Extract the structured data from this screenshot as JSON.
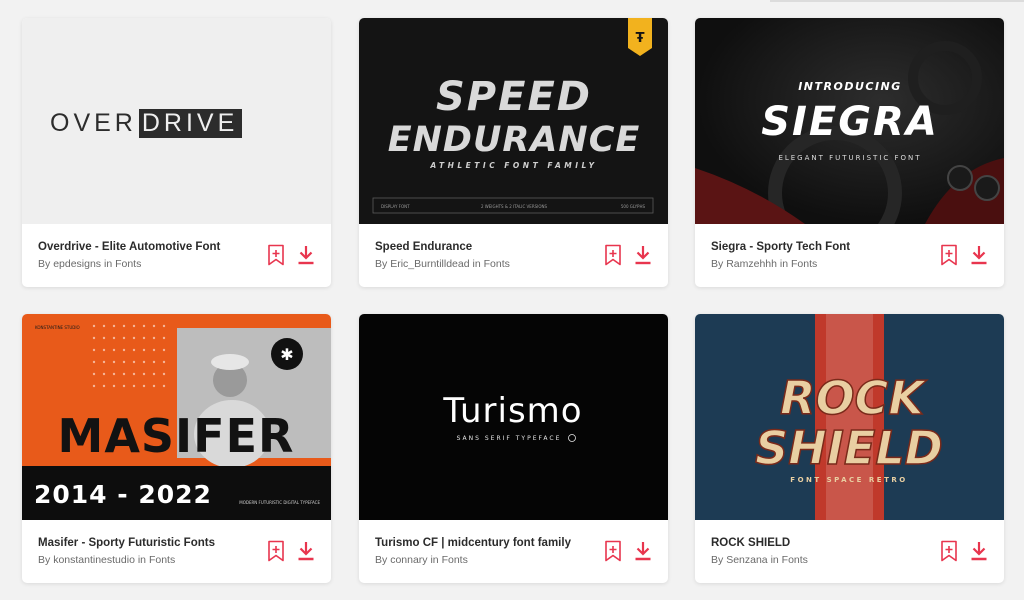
{
  "cards": [
    {
      "title": "Overdrive - Elite Automotive Font",
      "by": "By",
      "author": "epdesigns",
      "in": "in",
      "category": "Fonts",
      "preview": {
        "word_a": "OVER",
        "word_b": "DRIVE"
      }
    },
    {
      "title": "Speed Endurance",
      "by": "By",
      "author": "Eric_Burntilldead",
      "in": "in",
      "category": "Fonts",
      "preview": {
        "line1": "SPEED",
        "line2": "ENDURANCE",
        "tagline": "ATHLETIC FONT FAMILY",
        "footer_left": "DISPLAY FONT",
        "footer_mid": "2 WEIGHTS & 2 ITALIC VERSIONS",
        "footer_right": "500 GLYPHS"
      }
    },
    {
      "title": "Siegra - Sporty Tech Font",
      "by": "By",
      "author": "Ramzehhh",
      "in": "in",
      "category": "Fonts",
      "preview": {
        "intro": "INTRODUCING",
        "name": "SIEGRA",
        "tagline": "ELEGANT FUTURISTIC FONT"
      }
    },
    {
      "title": "Masifer - Sporty Futuristic Fonts",
      "by": "By",
      "author": "konstantinestudio",
      "in": "in",
      "category": "Fonts",
      "preview": {
        "studio": "KONSTANTINE STUDIO",
        "name": "MASIFER",
        "years": "2014 - 2022",
        "tagline": "MODERN FUTURISTIC DIGITAL TYPEFACE"
      }
    },
    {
      "title": "Turismo CF | midcentury font family",
      "by": "By",
      "author": "connary",
      "in": "in",
      "category": "Fonts",
      "preview": {
        "name": "Turismo",
        "tagline": "SANS SERIF TYPEFACE"
      }
    },
    {
      "title": "ROCK SHIELD",
      "by": "By",
      "author": "Senzana",
      "in": "in",
      "category": "Fonts",
      "preview": {
        "line1": "ROCK",
        "line2": "SHIELD",
        "tagline": "FONT SPACE RETRO"
      }
    }
  ],
  "icons": {
    "bookmark": "bookmark-icon",
    "download": "download-icon",
    "badge": "ribbon-badge-icon"
  },
  "colors": {
    "accent": "#e8354e",
    "background": "#f2f2f2",
    "card": "#ffffff"
  }
}
